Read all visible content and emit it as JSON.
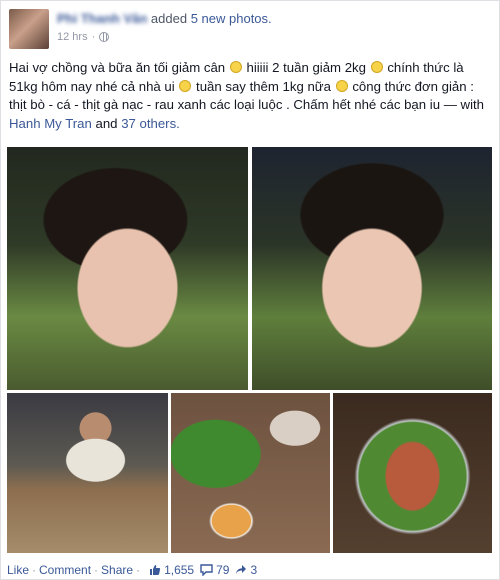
{
  "post": {
    "author": "Phi Thanh Vân",
    "action": "added",
    "photos_link": "5 new photos.",
    "time": "12 hrs",
    "separator": "·",
    "caption": {
      "part1": "Hai vợ chồng và bữa ăn tối giảm cân",
      "part2": "hiiiii 2 tuần giảm 2kg",
      "part3": "chính thức là 51kg hôm nay nhé cả nhà ui",
      "part4": "tuần say thêm 1kg nữa",
      "part5": "công thức đơn giản : thịt bò - cá - thịt gà nạc - rau xanh các loại luộc . Chấm hết nhé các bạn iu — with",
      "tagged_name": "Hanh My Tran",
      "and": "and",
      "others_link": "37 others."
    },
    "photos": [
      {
        "icon": "selfie-photo"
      },
      {
        "icon": "selfie-photo"
      },
      {
        "icon": "dinner-photo"
      },
      {
        "icon": "vegetables-photo"
      },
      {
        "icon": "steamed-fish-photo"
      }
    ]
  },
  "actions": {
    "like": "Like",
    "comment": "Comment",
    "share": "Share",
    "dot": "·",
    "likes_count": "1,655",
    "comments_count": "79",
    "shares_count": "3"
  },
  "colors": {
    "link": "#3b5998",
    "text": "#141823",
    "muted": "#9197a3"
  }
}
